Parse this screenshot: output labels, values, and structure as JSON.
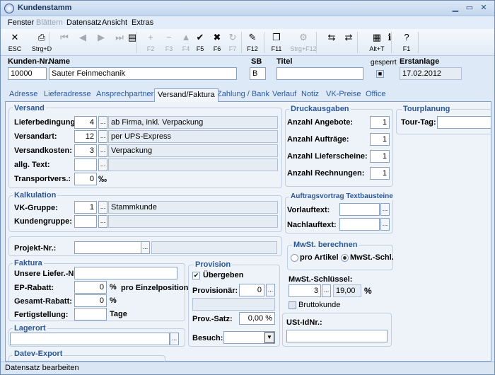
{
  "window": {
    "title": "Kundenstamm"
  },
  "menu": [
    "Fenster",
    "Blättern",
    "Datensatz",
    "Ansicht",
    "Extras"
  ],
  "toolbar": [
    {
      "icon": "✕",
      "label": "ESC",
      "name": "esc-icon",
      "dis": false
    },
    {
      "icon": "⎙",
      "label": "Strg+D",
      "name": "print-icon",
      "dis": false
    },
    {
      "icon": "⏮",
      "label": "",
      "name": "first-record-icon",
      "dis": true
    },
    {
      "icon": "◀",
      "label": "",
      "name": "prev-record-icon",
      "dis": true
    },
    {
      "icon": "▶",
      "label": "",
      "name": "next-record-icon",
      "dis": true
    },
    {
      "icon": "⏭",
      "label": "",
      "name": "last-record-icon",
      "dis": true
    },
    {
      "icon": "▤",
      "label": "",
      "name": "list-view-icon",
      "dis": false
    },
    {
      "icon": "+",
      "label": "F2",
      "name": "add-icon",
      "dis": true
    },
    {
      "icon": "−",
      "label": "F3",
      "name": "delete-icon",
      "dis": true
    },
    {
      "icon": "▲",
      "label": "F4",
      "name": "up-icon",
      "dis": true
    },
    {
      "icon": "✔",
      "label": "F5",
      "name": "save-icon",
      "dis": false
    },
    {
      "icon": "✖",
      "label": "F6",
      "name": "cancel-icon",
      "dis": false
    },
    {
      "icon": "↻",
      "label": "F7",
      "name": "refresh-icon",
      "dis": true
    },
    {
      "icon": "✎",
      "label": "F12",
      "name": "edit-icon",
      "dis": false
    },
    {
      "icon": "❐",
      "label": "F11",
      "name": "copy-icon",
      "dis": false
    },
    {
      "icon": "⚙",
      "label": "Strg+F12",
      "name": "settings-icon",
      "dis": true
    },
    {
      "icon": "⇆",
      "label": "",
      "name": "exchange-icon",
      "dis": false
    },
    {
      "icon": "⇄",
      "label": "",
      "name": "transfer-icon",
      "dis": false
    },
    {
      "icon": "▦",
      "label": "Alt+T",
      "name": "table-icon",
      "dis": false
    },
    {
      "icon": "ℹ",
      "label": "",
      "name": "info-icon",
      "dis": false
    },
    {
      "icon": "?",
      "label": "F1",
      "name": "help-icon",
      "dis": false
    }
  ],
  "header": {
    "kdnr_label": "Kunden-Nr.",
    "kdnr": "10000",
    "name_label": "Name",
    "name": "Sauter Feinmechanik",
    "sb_label": "SB",
    "sb": "B",
    "titel_label": "Titel",
    "titel": "",
    "gesperrt_label": "gesperrt",
    "erstanlage_label": "Erstanlage",
    "erstanlage": "17.02.2012"
  },
  "tabs": [
    "Adresse",
    "Lieferadresse",
    "Ansprechpartner",
    "Versand/Faktura",
    "Zahlung / Bank",
    "Verlauf",
    "Notiz",
    "VK-Preise",
    "Office"
  ],
  "active_tab": "Versand/Faktura",
  "versand": {
    "title": "Versand",
    "lieferbedingung_label": "Lieferbedingung:",
    "lieferbedingung": "4",
    "lieferbedingung_text": "ab Firma, inkl. Verpackung",
    "versandart_label": "Versandart:",
    "versandart": "12",
    "versandart_text": "per UPS-Express",
    "versandkosten_label": "Versandkosten:",
    "versandkosten": "3",
    "versandkosten_text": "Verpackung",
    "allg_text_label": "allg. Text:",
    "transportvers_label": "Transportvers.:",
    "transportvers": "0",
    "permille": "‰"
  },
  "kalkulation": {
    "title": "Kalkulation",
    "vk_gruppe_label": "VK-Gruppe:",
    "vk_gruppe": "1",
    "vk_gruppe_text": "Stammkunde",
    "kundengruppe_label": "Kundengruppe:"
  },
  "projekt": {
    "label": "Projekt-Nr.:"
  },
  "faktura": {
    "title": "Faktura",
    "unsere_label": "Unsere Liefer.-Nr:",
    "ep_rabatt_label": "EP-Rabatt:",
    "ep_rabatt": "0",
    "ep_unit": "%",
    "ep_suffix": "pro Einzelposition",
    "gesamt_rabatt_label": "Gesamt-Rabatt:",
    "gesamt_rabatt": "0",
    "gesamt_unit": "%",
    "fertigstellung_label": "Fertigstellung:",
    "fertigstellung_unit": "Tage"
  },
  "lagerort": {
    "title": "Lagerort"
  },
  "datev": {
    "title": "Datev-Export"
  },
  "provision": {
    "title": "Provision",
    "uebergeben_label": "Übergeben",
    "provisionaer_label": "Provisionär:",
    "provisionaer": "0",
    "prov_satz_label": "Prov.-Satz:",
    "prov_satz": "0,00 %",
    "besuch_label": "Besuch:"
  },
  "druck": {
    "title": "Druckausgaben",
    "angebote_label": "Anzahl Angebote:",
    "angebote": "1",
    "auftraege_label": "Anzahl Aufträge:",
    "auftraege": "1",
    "lieferscheine_label": "Anzahl Lieferscheine:",
    "lieferscheine": "1",
    "rechnungen_label": "Anzahl Rechnungen:",
    "rechnungen": "1"
  },
  "textbausteine": {
    "title": "Auftragsvortrag Textbausteine",
    "vorlauf_label": "Vorlauftext:",
    "nachlauf_label": "Nachlauftext:"
  },
  "mwst": {
    "title": "MwSt. berechnen",
    "pro_artikel": "pro Artikel",
    "mwst_schl": "MwSt.-Schl.",
    "schluessel_label": "MwSt.-Schlüssel:",
    "schluessel": "3",
    "satz": "19,00",
    "unit": "%",
    "bruttokunde": "Bruttokunde"
  },
  "ustid": {
    "label": "USt-IdNr.:"
  },
  "tourplanung": {
    "title": "Tourplanung",
    "tourtag_label": "Tour-Tag:"
  },
  "status": "Datensatz bearbeiten"
}
